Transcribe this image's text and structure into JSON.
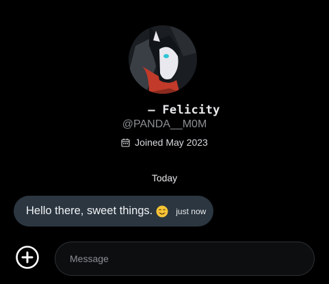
{
  "profile": {
    "display_name": "— Felicity",
    "handle": "@PANDA__M0M",
    "joined": "Joined May 2023"
  },
  "conversation": {
    "day_separator": "Today",
    "messages": [
      {
        "text": "Hello there, sweet things.",
        "emoji": "smiling-face-emoji",
        "time": "just now"
      }
    ]
  },
  "composer": {
    "placeholder": "Message",
    "add_icon": "plus-circle-icon"
  },
  "colors": {
    "background": "#000000",
    "bubble": "#2b3640",
    "muted_text": "#8b8f94",
    "primary_text": "#e7e9ea"
  }
}
